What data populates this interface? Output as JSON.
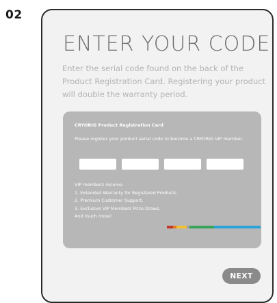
{
  "step_number": "02",
  "title": "ENTER YOUR CODE",
  "instructions": "Enter the serial code found on the back of the Product Registration Card.  Registering your product will double the warranty period.",
  "card": {
    "title": "CRYORIG Product Registration Card",
    "description": "Please register your product serial code to become a CRYORIG VIP member.",
    "code_fields": [
      "",
      "",
      "",
      ""
    ],
    "benefits_heading": "VIP members receive:",
    "benefits": [
      "1. Extended Warranty for Registered Products.",
      "2. Premium Customer Support.",
      "3. Exclusive VIP Members Prize Draws."
    ],
    "benefits_footer": "And much more!",
    "stripe_colors": [
      "#c0392b",
      "#e87722",
      "#f2c12e",
      "#a0a0a0",
      "#3aa35a",
      "#2aa3d8"
    ]
  },
  "next_button_label": "NEXT",
  "colors": {
    "panel_background": "#f2f2f2",
    "panel_border": "#2a2a2a",
    "card_background": "#b7b7b7",
    "button_background": "#8a8a8a"
  }
}
